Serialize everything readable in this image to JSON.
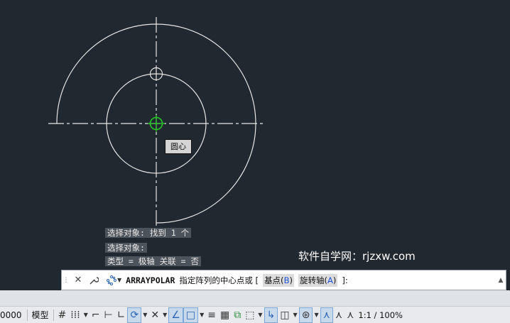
{
  "canvas": {
    "tooltip": "圆心",
    "history": [
      "选择对象: 找到 1 个",
      "选择对象:",
      "类型 = 极轴  关联 = 否"
    ],
    "watermark": "软件自学网：rjzxw.com"
  },
  "command": {
    "name": "ARRAYPOLAR",
    "prompt": "指定阵列的中心点或 [",
    "options": [
      {
        "label": "基点(",
        "key": "B",
        "close": ")"
      },
      {
        "label": "旋转轴(",
        "key": "A",
        "close": ")"
      }
    ],
    "suffix": "]:"
  },
  "status": {
    "coords_tail": "0000",
    "model_label": "模型",
    "scale_label": "1:1 / 100%"
  },
  "icons": [
    "close-icon",
    "wrench-icon",
    "array-icon",
    "grid-icon",
    "snap-icon",
    "ortho-icon",
    "polar-icon",
    "osnap-icon",
    "dynucs-icon",
    "lineweight-icon",
    "transparency-icon",
    "selection-cycling-icon",
    "3dosnap-icon",
    "gizmo-icon",
    "annotation-icon",
    "autoscale-icon"
  ],
  "colors": {
    "background": "#212830",
    "geometry": "#e6e6e6",
    "snap_marker": "#28c828"
  }
}
